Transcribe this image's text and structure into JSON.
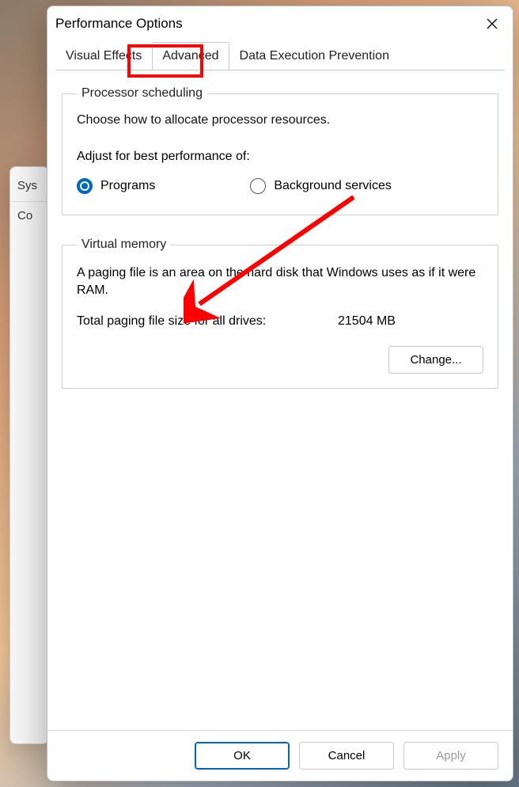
{
  "window": {
    "title": "Performance Options"
  },
  "tabs": {
    "visual_effects": "Visual Effects",
    "advanced": "Advanced",
    "dep": "Data Execution Prevention"
  },
  "processor": {
    "legend": "Processor scheduling",
    "desc": "Choose how to allocate processor resources.",
    "adjust_label": "Adjust for best performance of:",
    "option_programs": "Programs",
    "option_services": "Background services"
  },
  "virtual_memory": {
    "legend": "Virtual memory",
    "desc": "A paging file is an area on the hard disk that Windows uses as if it were RAM.",
    "total_label": "Total paging file size for all drives:",
    "total_value": "21504 MB",
    "change_button": "Change..."
  },
  "footer": {
    "ok": "OK",
    "cancel": "Cancel",
    "apply": "Apply"
  },
  "bg": {
    "sys": "Sys",
    "co": "Co"
  }
}
